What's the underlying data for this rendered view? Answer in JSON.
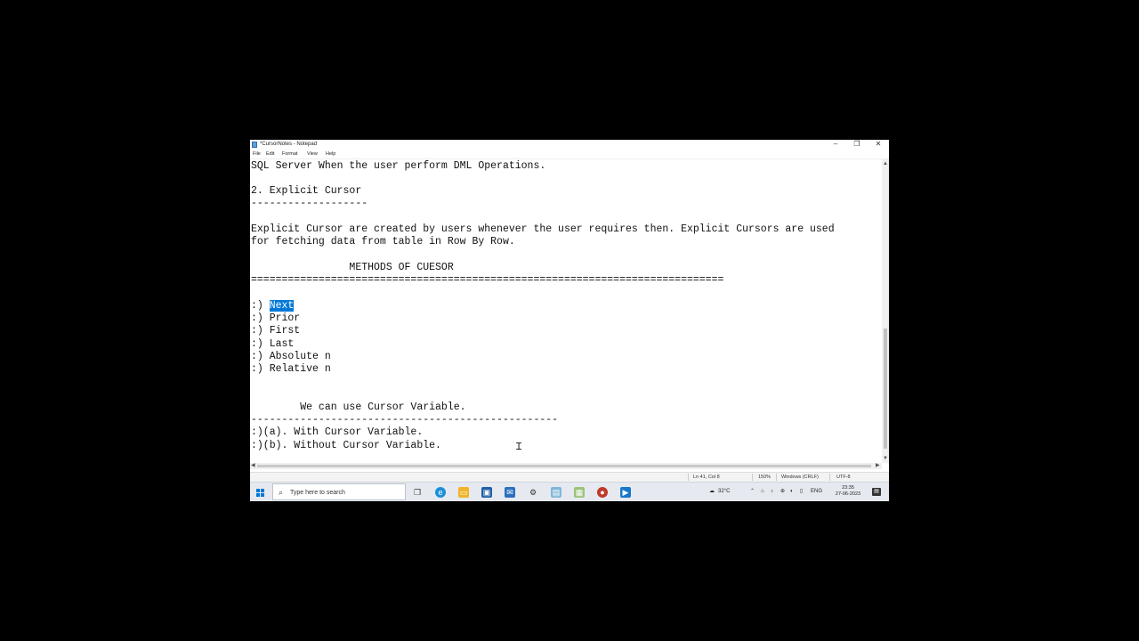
{
  "window": {
    "title": "*CursorNotes - Notepad",
    "minimize": "–",
    "maximize": "❐",
    "close": "✕"
  },
  "menu": [
    "File",
    "Edit",
    "Format",
    "View",
    "Help"
  ],
  "editor": {
    "line_prefix": ":) ",
    "selected_text": "Next",
    "lines": [
      "SQL Server When the user perform DML Operations.",
      "",
      "2. Explicit Cursor",
      "-------------------",
      "",
      "Explicit Cursor are created by users whenever the user requires then. Explicit Cursors are used",
      "for fetching data from table in Row By Row.",
      "",
      "                METHODS OF CUESOR",
      "=============================================================================",
      "",
      "",
      ":) Prior",
      ":) First",
      ":) Last",
      ":) Absolute n",
      ":) Relative n",
      "",
      "",
      "        We can use Cursor Variable.",
      "--------------------------------------------------",
      ":)(a). With Cursor Variable.",
      ":)(b). Without Cursor Variable."
    ]
  },
  "status": {
    "position": "Ln 41, Col 8",
    "zoom": "150%",
    "line_ending": "Windows (CRLF)",
    "encoding": "UTF-8"
  },
  "taskbar": {
    "search_placeholder": "Type here to search",
    "weather": "32°C",
    "language": "ENG",
    "time": "23:35",
    "date": "27-06-2023"
  },
  "colors": {
    "selection": "#0078d7",
    "windows_blue": "#0078d7"
  }
}
